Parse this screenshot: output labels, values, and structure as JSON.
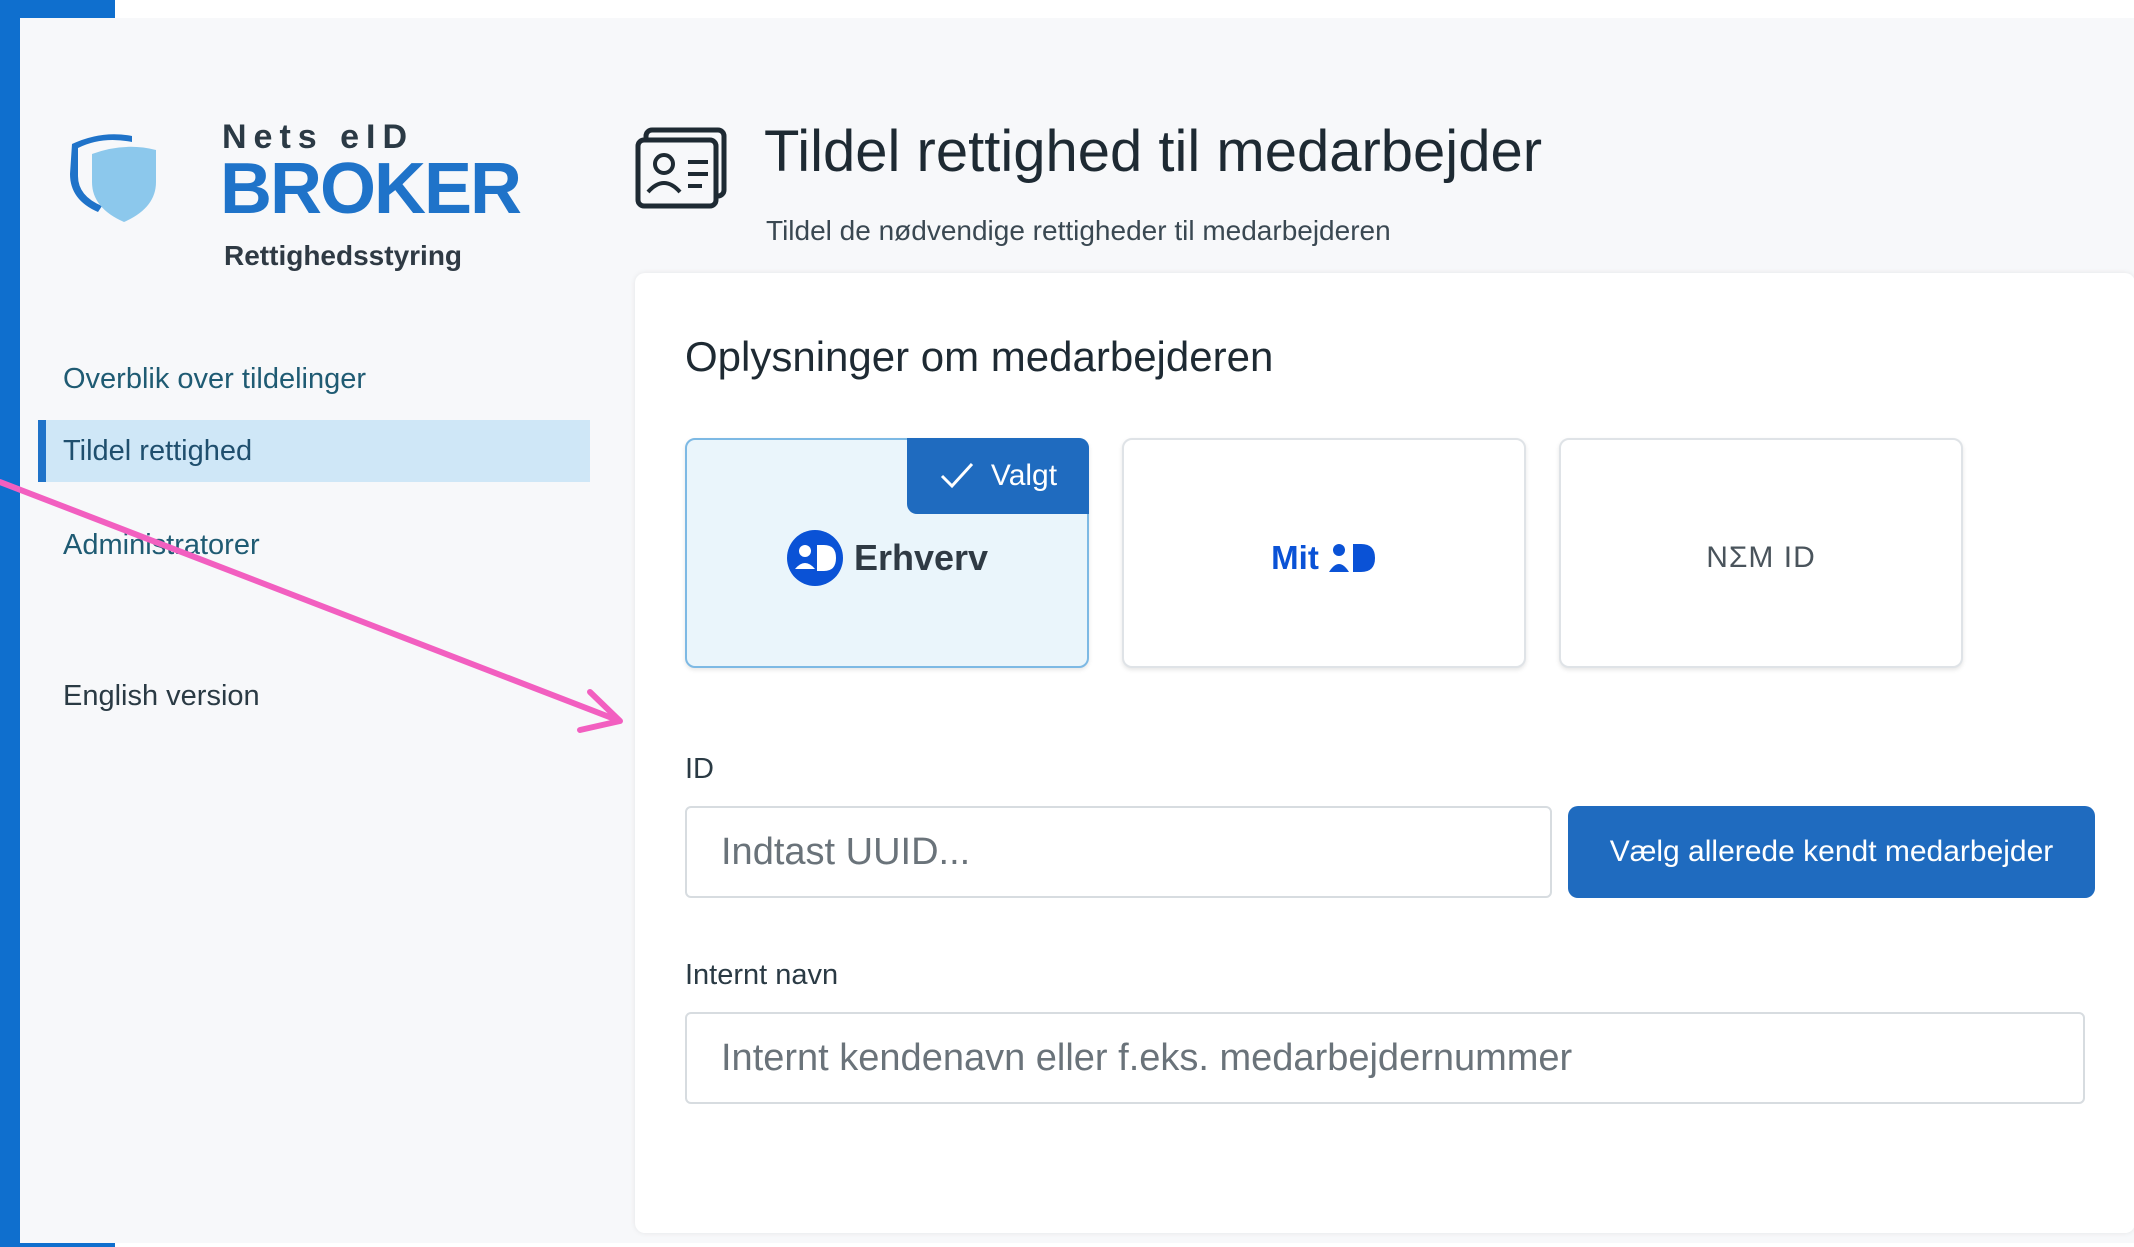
{
  "logo": {
    "line1": "Nets eID",
    "line2": "BROKER",
    "subtitle": "Rettighedsstyring"
  },
  "sidebar": {
    "items": [
      {
        "label": "Overblik over tildelinger",
        "active": false
      },
      {
        "label": "Tildel rettighed",
        "active": true
      },
      {
        "label": "Administratorer",
        "active": false
      }
    ],
    "language_link": "English version"
  },
  "header": {
    "icon": "id-card-icon",
    "title": "Tildel rettighed til medarbejder",
    "subtitle": "Tildel de nødvendige rettigheder til medarbejderen"
  },
  "form": {
    "section_title": "Oplysninger om medarbejderen",
    "id_options": [
      {
        "label": "Erhverv",
        "icon": "mitid-circle-icon",
        "selected": true,
        "badge": "Valgt"
      },
      {
        "label": "Mit",
        "icon": "mitid-logo-icon",
        "selected": false
      },
      {
        "label": "NΣM ID",
        "icon": "nemid-logo",
        "selected": false
      }
    ],
    "id_label": "ID",
    "id_placeholder": "Indtast UUID...",
    "known_button": "Vælg allerede kendt medarbejder",
    "name_label": "Internt navn",
    "name_placeholder": "Internt kendenavn eller f.eks. medarbejdernummer"
  },
  "colors": {
    "brand_blue": "#1f6bbf",
    "active_nav_bg": "#cfe7f7",
    "annotation_arrow": "#f25fc0"
  }
}
